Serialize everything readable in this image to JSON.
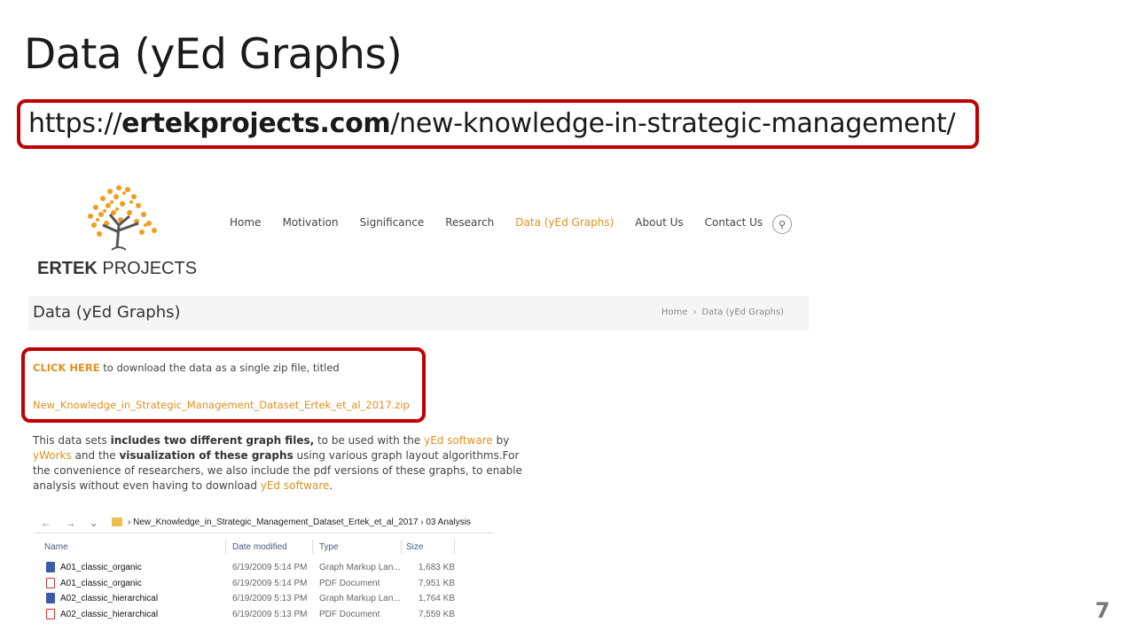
{
  "slide": {
    "title": "Data (yEd Graphs)",
    "url_prefix": "https://",
    "url_domain": "ertekprojects.com",
    "url_path": "/new-knowledge-in-strategic-management/",
    "page_number": "7"
  },
  "website": {
    "logo_bold": "ERTEK",
    "logo_rest": " PROJECTS",
    "nav": [
      "Home",
      "Motivation",
      "Significance",
      "Research",
      "Data (yEd Graphs)",
      "About Us",
      "Contact Us"
    ],
    "active_nav": "Data (yEd Graphs)",
    "page_title": "Data (yEd Graphs)",
    "breadcrumb": [
      "Home",
      "Data (yEd Graphs)"
    ],
    "download": {
      "click_label": "CLICK HERE",
      "line1_rest": " to download the data as a single zip file, titled",
      "filename": "New_Knowledge_in_Strategic_Management_Dataset_Ertek_et_al_2017.zip"
    },
    "description": {
      "p1": "This data sets ",
      "b1": "includes two different graph files,",
      "p2": " to be used with the ",
      "l1": "yEd software",
      "p3": " by ",
      "l2": "yWorks",
      "p4": " and the ",
      "b2": "visualization of these graphs",
      "p5": " using various graph layout algorithms.For the convenience of researchers, we also include the pdf versions of these graphs, to enable analysis without even having to download ",
      "l3": "yEd software",
      "p6": "."
    },
    "colors": {
      "accent": "#e0901f",
      "highlight_box": "#c00000"
    }
  },
  "explorer": {
    "path": [
      "New_Knowledge_in_Strategic_Management_Dataset_Ertek_et_al_2017",
      "03 Analysis"
    ],
    "columns": [
      "Name",
      "Date modified",
      "Type",
      "Size"
    ],
    "rows": [
      {
        "name": "A01_classic_organic",
        "date": "6/19/2009 5:14 PM",
        "type": "Graph Markup Lan...",
        "size": "1,683 KB",
        "icon": "graphml-file-icon"
      },
      {
        "name": "A01_classic_organic",
        "date": "6/19/2009 5:14 PM",
        "type": "PDF Document",
        "size": "7,951 KB",
        "icon": "pdf-file-icon"
      },
      {
        "name": "A02_classic_hierarchical",
        "date": "6/19/2009 5:13 PM",
        "type": "Graph Markup Lan...",
        "size": "1,764 KB",
        "icon": "graphml-file-icon"
      },
      {
        "name": "A02_classic_hierarchical",
        "date": "6/19/2009 5:13 PM",
        "type": "PDF Document",
        "size": "7,559 KB",
        "icon": "pdf-file-icon"
      }
    ]
  }
}
